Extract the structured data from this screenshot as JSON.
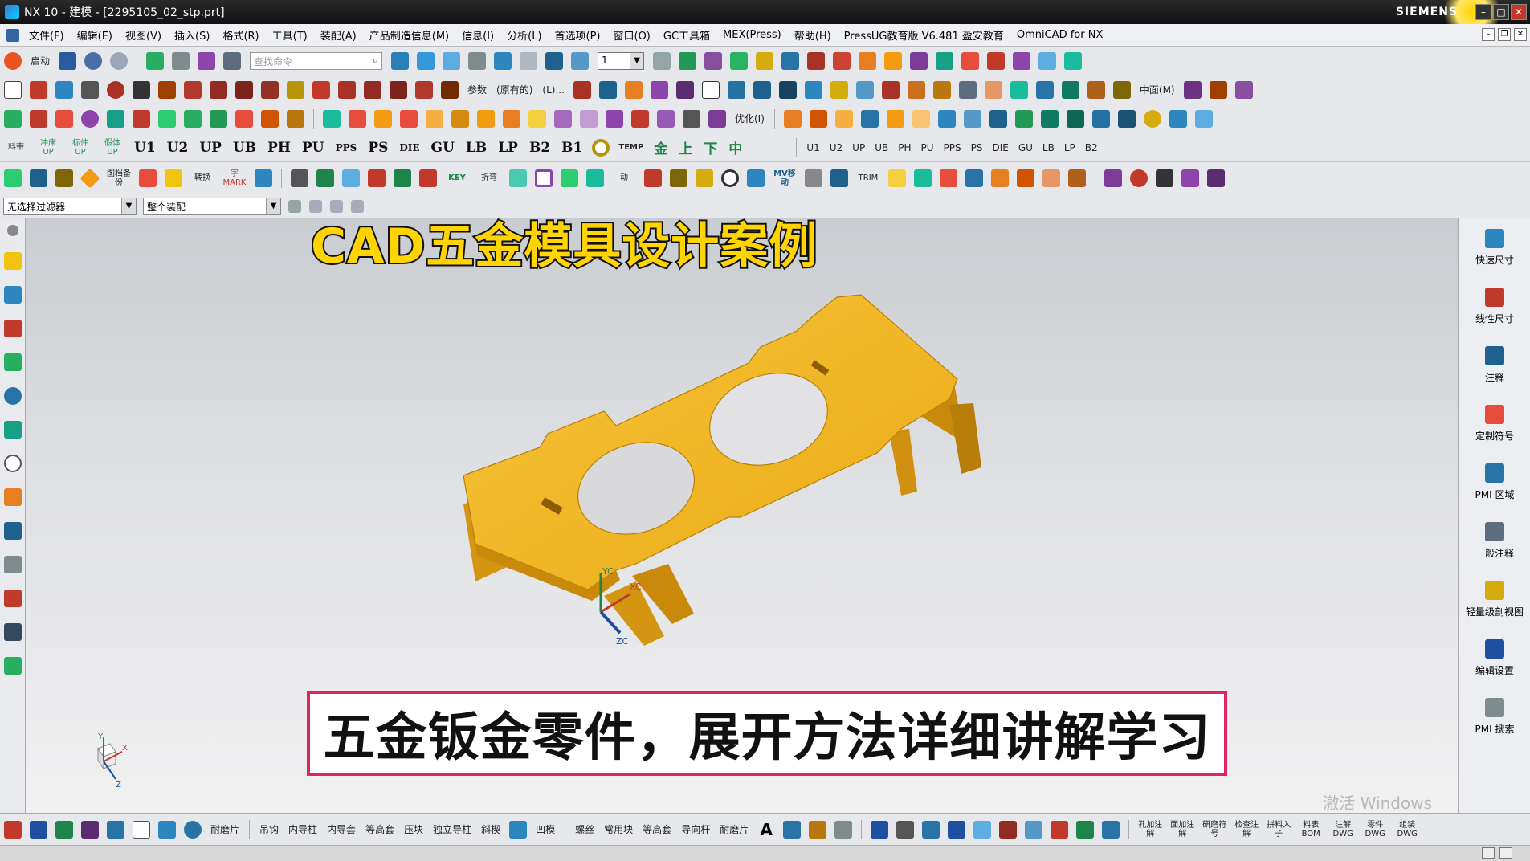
{
  "window": {
    "title": "NX 10 - 建模 - [2295105_02_stp.prt]",
    "brand": "SIEMENS"
  },
  "menu": {
    "items": [
      "文件(F)",
      "编辑(E)",
      "视图(V)",
      "插入(S)",
      "格式(R)",
      "工具(T)",
      "装配(A)",
      "产品制造信息(M)",
      "信息(I)",
      "分析(L)",
      "首选项(P)",
      "窗口(O)",
      "GC工具箱",
      "MEX(Press)",
      "帮助(H)",
      "PressUG教育版 V6.481 盈安教育",
      "OmniCAD for NX"
    ]
  },
  "toolbar1": {
    "start_label": "启动",
    "search_placeholder": "查找命令",
    "layer_value": "1"
  },
  "toolbar2": {
    "param_label": "参数",
    "original_label": "(原有的)",
    "l_label": "(L)...",
    "middle_label": "中面(M)"
  },
  "toolbar3": {
    "optimize_label": "优化(I)"
  },
  "toolbar4": {
    "labels": [
      "料带",
      "冲床UP",
      "标件UP",
      "假体UP",
      "U1",
      "U2",
      "UP",
      "UB",
      "PH",
      "PU",
      "PPS",
      "PS",
      "DIE",
      "GU",
      "LB",
      "LP",
      "B2",
      "B1"
    ],
    "temp_label": "TEMP",
    "jin_label": "金",
    "shang_label": "上",
    "xia_label": "下",
    "zhong_label": "中",
    "right_labels": [
      "U1",
      "U2",
      "UP",
      "UB",
      "PH",
      "PU",
      "PPS",
      "PS",
      "DIE",
      "GU",
      "LB",
      "LP",
      "B2"
    ]
  },
  "toolbar5": {
    "labels": [
      "图档备份",
      "转换",
      "字MARK",
      "KEY",
      "折弯",
      "动",
      "MV移动",
      "TRIM"
    ]
  },
  "filter": {
    "selection_filter": "无选择过滤器",
    "scope": "整个装配"
  },
  "viewport": {
    "headline": "CAD五金模具设计案例",
    "subtitle": "五金钣金零件，展开方法详细讲解学习",
    "watermark": "激活 Windows",
    "csys_labels": {
      "yc": "YC",
      "xc": "XC",
      "zc": "ZC",
      "x": "X",
      "y": "Y",
      "z": "Z"
    }
  },
  "pmi_panel": {
    "items": [
      "快速尺寸",
      "线性尺寸",
      "注释",
      "定制符号",
      "PMI 区域",
      "一般注释",
      "轻量级剖视图",
      "编辑设置",
      "PMI 搜索"
    ]
  },
  "bottom_toolbar": {
    "labels": [
      "耐磨片",
      "吊钩",
      "内导柱",
      "内导套",
      "等高套",
      "压块",
      "独立导柱",
      "斜楔",
      "凹模",
      "螺丝",
      "常用块",
      "等高套",
      "导向杆",
      "耐磨片"
    ],
    "right_labels": [
      "孔加注解",
      "面加注解",
      "研磨符号",
      "检查注解",
      "拼料入子",
      "料表BOM",
      "注解DWG",
      "零件DWG",
      "组装DWG"
    ]
  },
  "colors": {
    "part": "#f4b61a",
    "part_dark": "#c8880a",
    "headline": "#ffd400",
    "subtitle_border": "#e0245e"
  }
}
